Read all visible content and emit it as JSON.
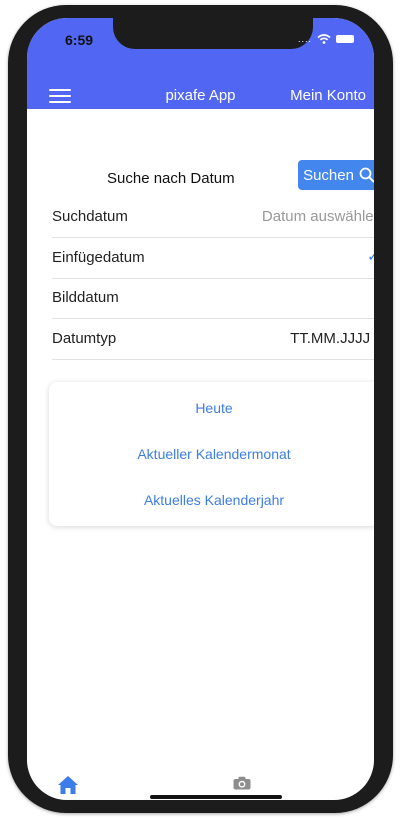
{
  "status_bar": {
    "time": "6:59",
    "carrier": "...."
  },
  "header": {
    "title": "pixafe App",
    "account": "Mein Konto"
  },
  "search": {
    "title": "Suche nach Datum",
    "button_label": "Suchen"
  },
  "form": {
    "rows": [
      {
        "label": "Suchdatum",
        "value": "Datum auswählen"
      },
      {
        "label": "Einfügedatum",
        "checked": true,
        "check_glyph": "✓"
      },
      {
        "label": "Bilddatum"
      },
      {
        "label": "Datumtyp",
        "value": "TT.MM.JJJJ"
      }
    ]
  },
  "quick_options": [
    "Heute",
    "Aktueller Kalendermonat",
    "Aktuelles Kalenderjahr"
  ],
  "tab_bar": {
    "items": [
      "home-icon",
      "camera-icon"
    ]
  },
  "colors": {
    "header": "#5167f4",
    "button": "#4386ee",
    "link": "#3d7ee6",
    "active_tab": "#3b7de9"
  }
}
